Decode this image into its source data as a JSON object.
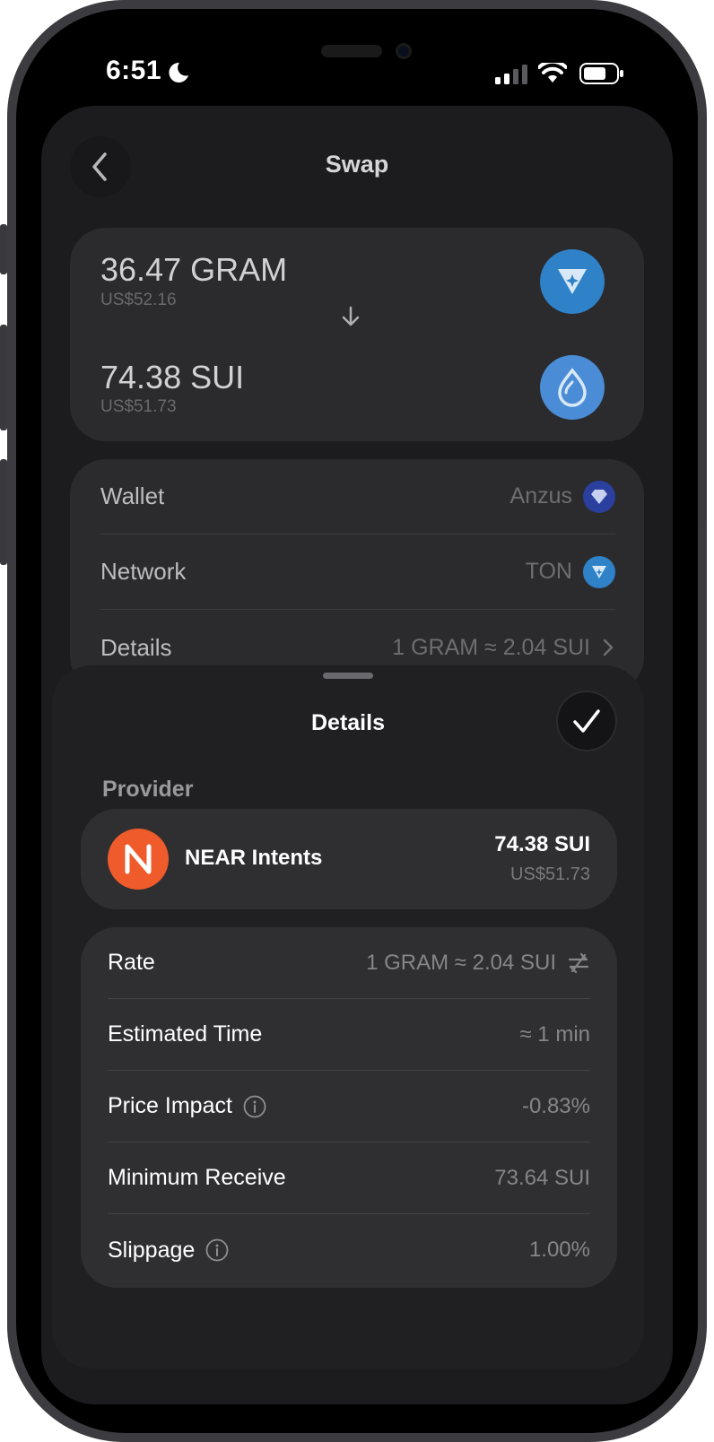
{
  "status_bar": {
    "time": "6:51"
  },
  "nav": {
    "title": "Swap"
  },
  "swap": {
    "from": {
      "amount": "36.47 GRAM",
      "fiat": "US$52.16",
      "icon": "ton-diamond-icon",
      "color": "#2f82c8"
    },
    "to": {
      "amount": "74.38 SUI",
      "fiat": "US$51.73",
      "icon": "sui-drop-icon",
      "color": "#4a8cd6"
    }
  },
  "info": {
    "wallet": {
      "label": "Wallet",
      "value": "Anzus"
    },
    "network": {
      "label": "Network",
      "value": "TON"
    },
    "details": {
      "label": "Details",
      "value": "1 GRAM ≈ 2.04 SUI"
    }
  },
  "sheet": {
    "title": "Details",
    "provider_label": "Provider",
    "provider": {
      "name": "NEAR Intents",
      "amount": "74.38 SUI",
      "fiat": "US$51.73",
      "color": "#ef5b2b"
    },
    "rows": {
      "rate": {
        "label": "Rate",
        "value": "1 GRAM ≈ 2.04 SUI"
      },
      "time": {
        "label": "Estimated Time",
        "value": "≈ 1 min"
      },
      "impact": {
        "label": "Price Impact",
        "value": "-0.83%"
      },
      "minimum": {
        "label": "Minimum Receive",
        "value": "73.64 SUI"
      },
      "slippage": {
        "label": "Slippage",
        "value": "1.00%"
      }
    }
  }
}
